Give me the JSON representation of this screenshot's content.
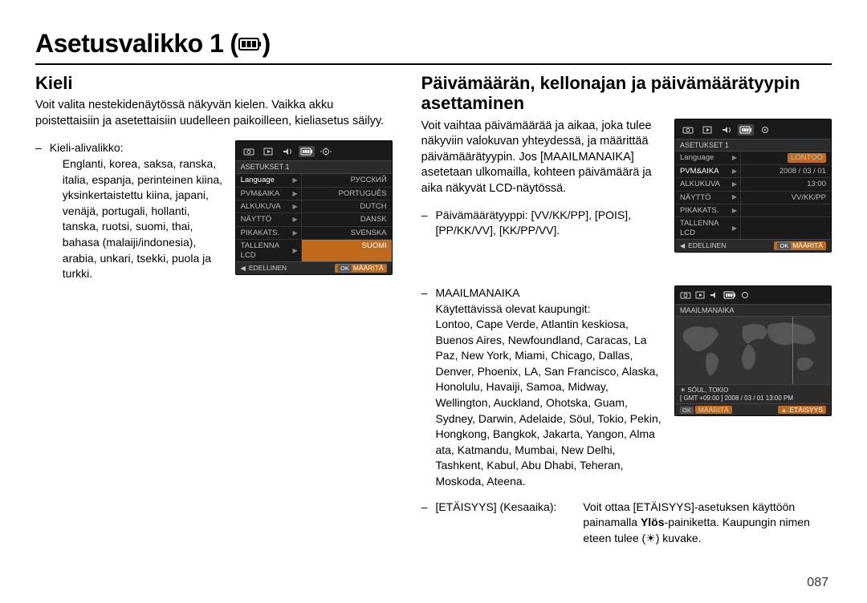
{
  "page": {
    "title": "Asetusvalikko 1",
    "number": "087"
  },
  "left": {
    "heading": "Kieli",
    "intro": "Voit valita nestekidenäytössä näkyvän kielen. Vaikka akku poistettaisiin ja asetettaisiin uudelleen paikoilleen, kieliasetus säilyy.",
    "bullet_label": "Kieli-alivalikko:",
    "bullet_text": "Englanti, korea, saksa, ranska, italia, espanja, perinteinen kiina, yksinkertaistettu kiina, japani, venäjä, portugali, hollanti, tanska, ruotsi, suomi, thai, bahasa (malaiji/indonesia), arabia, unkari, tsekki, puola ja turkki."
  },
  "lcd_language": {
    "panel": "ASETUKSET 1",
    "rows": [
      {
        "l": "Language",
        "r": "РУССКИЙ",
        "sel_left": true
      },
      {
        "l": "PVM&AIKA",
        "r": "PORTUGUÊS"
      },
      {
        "l": "ALKUKUVA",
        "r": "DUTCH"
      },
      {
        "l": "NÄYTTÖ",
        "r": "DANSK"
      },
      {
        "l": "PIKAKATS.",
        "r": "SVENSKA"
      },
      {
        "l": "TALLENNA LCD",
        "r": "SUOMI",
        "sel_right": true
      }
    ],
    "footer_left": "EDELLINEN",
    "footer_ok": "OK",
    "footer_right": "MÄÄRITÄ"
  },
  "right": {
    "heading": "Päivämäärän, kellonajan ja päivämäärä­tyypin asettaminen",
    "intro": "Voit vaihtaa päivämäärää ja aikaa, joka tulee näkyviin valokuvan yhteydessä, ja määrittää päivämäärätyypin. Jos [MAAILMANAIKA] asetetaan ulkomailla, kohteen päivämäärä ja aika näkyvät LCD-näytössä.",
    "datefmt_label": "Päivämäärätyyppi:",
    "datefmt_values": "[VV/KK/PP], [POIS], [PP/KK/VV], [KK/PP/VV].",
    "world_label": "MAAILMANAIKA",
    "world_sub": "Käytettävissä olevat kaupungit:",
    "world_cities": "Lontoo, Cape Verde, Atlantin keskiosa, Buenos Aires, Newfoundland, Caracas, La Paz, New York, Miami, Chicago, Dallas, Denver, Phoenix, LA, San Francisco, Alaska, Honolulu, Havaiji, Samoa, Midway, Wellington, Auckland, Ohotska, Guam, Sydney, Darwin, Adelaide, Söul, Tokio, Pekin, Hongkong, Bangkok, Jakarta, Yangon, Alma ata, Katmandu, Mumbai, New Delhi, Tashkent, Kabul, Abu Dhabi, Teheran, Moskoda, Ateena.",
    "dst_label": "[ETÄISYYS] (Kesaaika):",
    "dst_text_a": "Voit ottaa [ETÄISYYS]-asetuksen käyttöön painamalla ",
    "dst_bold": "Ylös",
    "dst_text_b": "-painiketta. Kaupungin nimen eteen tulee (",
    "dst_text_c": ") kuvake."
  },
  "lcd_datetime": {
    "panel": "ASETUKSET 1",
    "rows": [
      {
        "l": "Language",
        "r": "LONTOO",
        "sel_right_pill": true
      },
      {
        "l": "PVM&AIKA",
        "r": "",
        "sel_left": true
      },
      {
        "l": "ALKUKUVA",
        "r": "2008 / 03 / 01"
      },
      {
        "l": "NÄYTTÖ",
        "r": "13:00"
      },
      {
        "l": "PIKAKATS.",
        "r": "VV/KK/PP"
      },
      {
        "l": "TALLENNA LCD",
        "r": ""
      }
    ],
    "footer_left": "EDELLINEN",
    "footer_ok": "OK",
    "footer_right": "MÄÄRITÄ"
  },
  "lcd_worldmap": {
    "panel": "MAAILMANAIKA",
    "city": "SÖUL, TOKIO",
    "gmt": "[ GMT +09:00 ] 2008 / 03 / 01  13:00 PM",
    "footer_ok": "OK",
    "footer_left": "MÄÄRITÄ",
    "footer_right": "ETÄISYYS"
  }
}
